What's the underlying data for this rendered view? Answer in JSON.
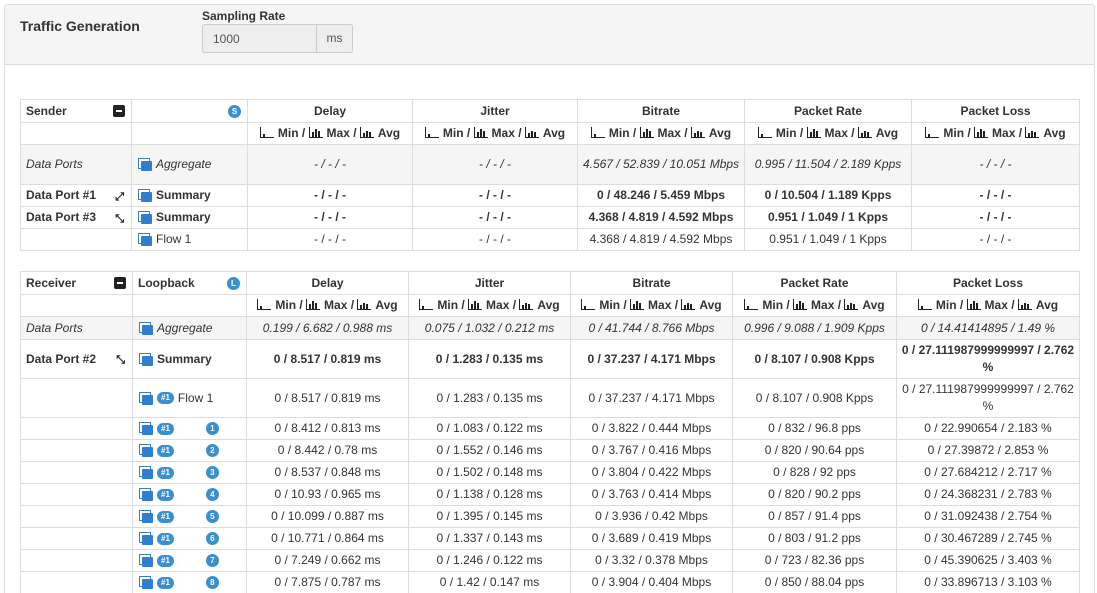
{
  "header": {
    "title": "Traffic Generation",
    "sampling_rate_label": "Sampling Rate",
    "sampling_rate_value": "1000",
    "sampling_rate_unit": "ms"
  },
  "colors": {
    "accent": "#3a8fd0",
    "header_bg": "#f5f5f5",
    "border": "#dddddd"
  },
  "stats_header": {
    "min": "Min /",
    "max": "Max /",
    "avg": "Avg"
  },
  "sender": {
    "title": "Sender",
    "badge": "S",
    "columns": [
      "Delay",
      "Jitter",
      "Bitrate",
      "Packet Rate",
      "Packet Loss"
    ],
    "rows": [
      {
        "port": "Data Ports",
        "name": "Aggregate",
        "delay": "- / - / -",
        "jitter": "- / - / -",
        "bitrate": "4.567 / 52.839 / 10.051 Mbps",
        "packet_rate": "0.995 / 11.504 / 2.189 Kpps",
        "packet_loss": "- / - / -"
      },
      {
        "port": "Data Port #1",
        "name": "Summary",
        "delay": "- / - / -",
        "jitter": "- / - / -",
        "bitrate": "0 / 48.246 / 5.459 Mbps",
        "packet_rate": "0 / 10.504 / 1.189 Kpps",
        "packet_loss": "- / - / -"
      },
      {
        "port": "Data Port #3",
        "name": "Summary",
        "delay": "- / - / -",
        "jitter": "- / - / -",
        "bitrate": "4.368 / 4.819 / 4.592 Mbps",
        "packet_rate": "0.951 / 1.049 / 1 Kpps",
        "packet_loss": "- / - / -"
      },
      {
        "port": "",
        "name": "Flow 1",
        "delay": "- / - / -",
        "jitter": "- / - / -",
        "bitrate": "4.368 / 4.819 / 4.592 Mbps",
        "packet_rate": "0.951 / 1.049 / 1 Kpps",
        "packet_loss": "- / - / -"
      }
    ]
  },
  "receiver": {
    "title": "Receiver",
    "subtitle": "Loopback",
    "badge": "L",
    "flow_badge": "#1",
    "columns": [
      "Delay",
      "Jitter",
      "Bitrate",
      "Packet Rate",
      "Packet Loss"
    ],
    "rows": [
      {
        "port": "Data Ports",
        "name": "Aggregate",
        "delay": "0.199 / 6.682 / 0.988 ms",
        "jitter": "0.075 / 1.032 / 0.212 ms",
        "bitrate": "0 / 41.744 / 8.766 Mbps",
        "packet_rate": "0.996 / 9.088 / 1.909 Kpps",
        "packet_loss": "0 / 14.41414895 / 1.49 %"
      },
      {
        "port": "Data Port #2",
        "name": "Summary",
        "delay": "0 / 8.517 / 0.819 ms",
        "jitter": "0 / 1.283 / 0.135 ms",
        "bitrate": "0 / 37.237 / 4.171 Mbps",
        "packet_rate": "0 / 8.107 / 0.908 Kpps",
        "packet_loss": "0 / 27.111987999999997 / 2.762 %"
      },
      {
        "port": "",
        "name": "Flow 1",
        "delay": "0 / 8.517 / 0.819 ms",
        "jitter": "0 / 1.283 / 0.135 ms",
        "bitrate": "0 / 37.237 / 4.171 Mbps",
        "packet_rate": "0 / 8.107 / 0.908 Kpps",
        "packet_loss": "0 / 27.111987999999997 / 2.762 %"
      },
      {
        "idx": "1",
        "delay": "0 / 8.412 / 0.813 ms",
        "jitter": "0 / 1.083 / 0.122 ms",
        "bitrate": "0 / 3.822 / 0.444 Mbps",
        "packet_rate": "0 / 832 / 96.8 pps",
        "packet_loss": "0 / 22.990654 / 2.183 %"
      },
      {
        "idx": "2",
        "delay": "0 / 8.442 / 0.78 ms",
        "jitter": "0 / 1.552 / 0.146 ms",
        "bitrate": "0 / 3.767 / 0.416 Mbps",
        "packet_rate": "0 / 820 / 90.64 pps",
        "packet_loss": "0 / 27.39872 / 2.853 %"
      },
      {
        "idx": "3",
        "delay": "0 / 8.537 / 0.848 ms",
        "jitter": "0 / 1.502 / 0.148 ms",
        "bitrate": "0 / 3.804 / 0.422 Mbps",
        "packet_rate": "0 / 828 / 92 pps",
        "packet_loss": "0 / 27.684212 / 2.717 %"
      },
      {
        "idx": "4",
        "delay": "0 / 10.93 / 0.965 ms",
        "jitter": "0 / 1.138 / 0.128 ms",
        "bitrate": "0 / 3.763 / 0.414 Mbps",
        "packet_rate": "0 / 820 / 90.2 pps",
        "packet_loss": "0 / 24.368231 / 2.783 %"
      },
      {
        "idx": "5",
        "delay": "0 / 10.099 / 0.887 ms",
        "jitter": "0 / 1.395 / 0.145 ms",
        "bitrate": "0 / 3.936 / 0.42 Mbps",
        "packet_rate": "0 / 857 / 91.4 pps",
        "packet_loss": "0 / 31.092438 / 2.754 %"
      },
      {
        "idx": "6",
        "delay": "0 / 10.771 / 0.864 ms",
        "jitter": "0 / 1.337 / 0.143 ms",
        "bitrate": "0 / 3.689 / 0.419 Mbps",
        "packet_rate": "0 / 803 / 91.2 pps",
        "packet_loss": "0 / 30.467289 / 2.745 %"
      },
      {
        "idx": "7",
        "delay": "0 / 7.249 / 0.662 ms",
        "jitter": "0 / 1.246 / 0.122 ms",
        "bitrate": "0 / 3.32 / 0.378 Mbps",
        "packet_rate": "0 / 723 / 82.36 pps",
        "packet_loss": "0 / 45.390625 / 3.403 %"
      },
      {
        "idx": "8",
        "delay": "0 / 7.875 / 0.787 ms",
        "jitter": "0 / 1.42 / 0.147 ms",
        "bitrate": "0 / 3.904 / 0.404 Mbps",
        "packet_rate": "0 / 850 / 88.04 pps",
        "packet_loss": "0 / 33.896713 / 3.103 %"
      }
    ]
  }
}
